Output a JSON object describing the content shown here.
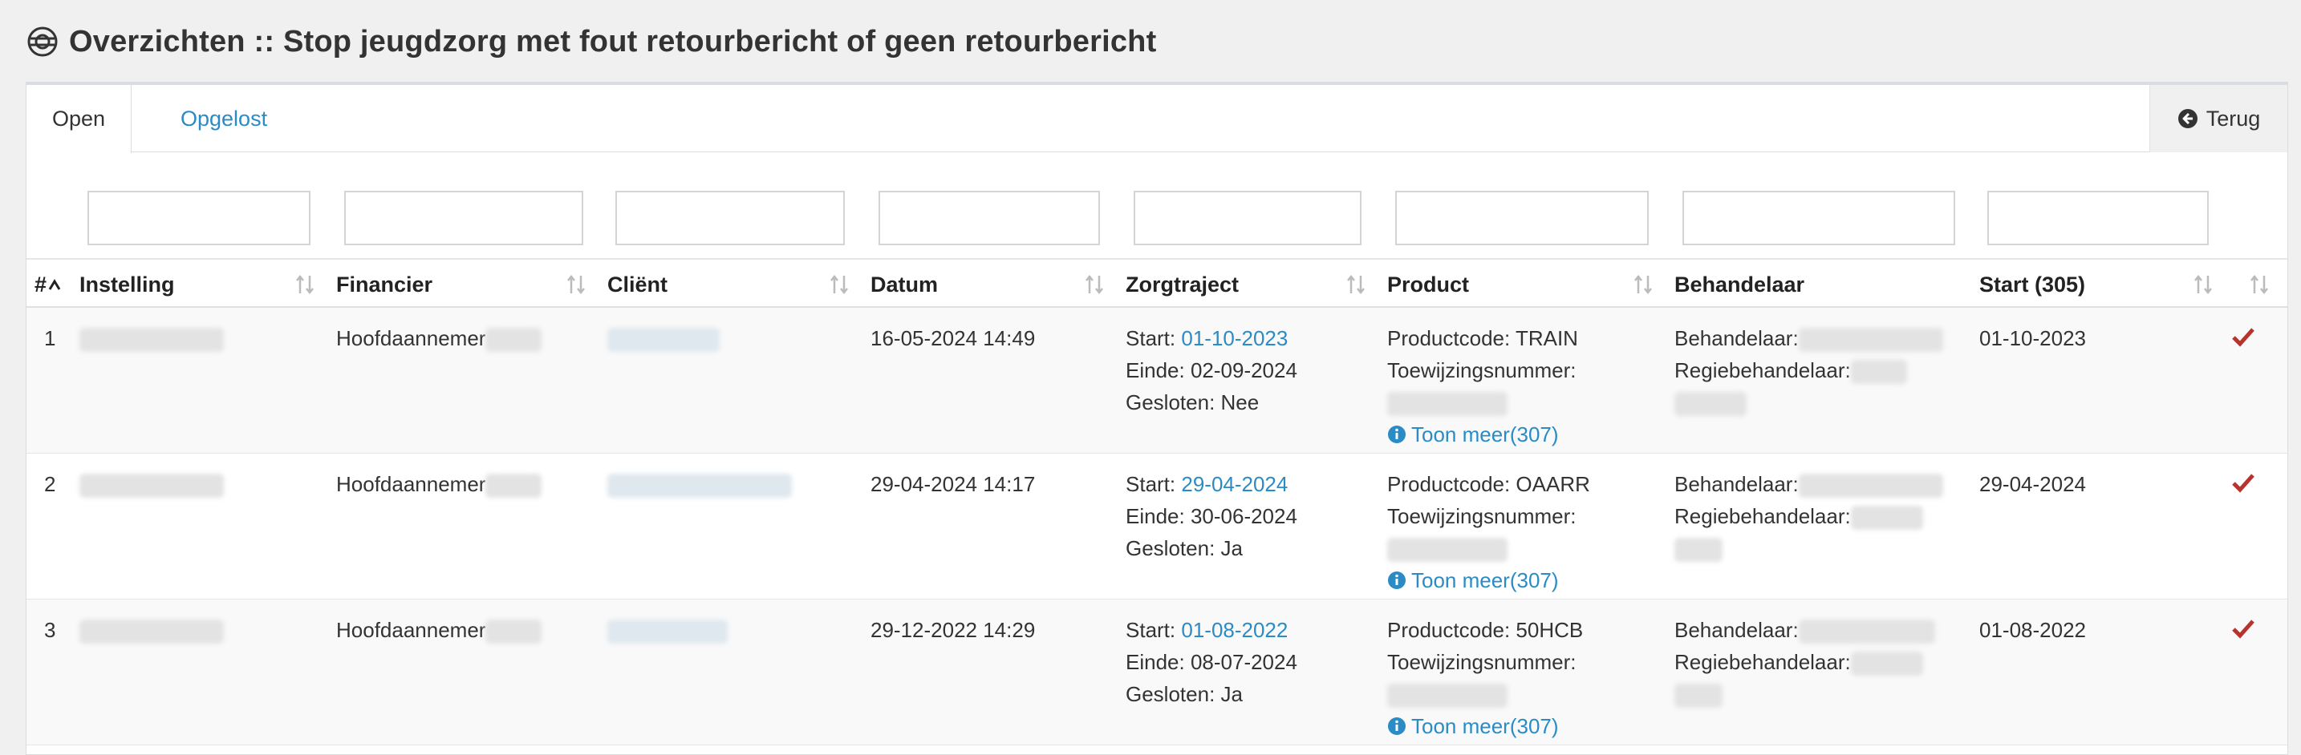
{
  "header": {
    "title": "Overzichten :: Stop jeugdzorg met fout retourbericht of geen retourbericht"
  },
  "tabs": [
    {
      "label": "Open"
    },
    {
      "label": "Opgelost"
    }
  ],
  "back_button": {
    "label": "Terug"
  },
  "columns": [
    {
      "label": "#"
    },
    {
      "label": "Instelling"
    },
    {
      "label": "Financier"
    },
    {
      "label": "Cliënt"
    },
    {
      "label": "Datum"
    },
    {
      "label": "Zorgtraject"
    },
    {
      "label": "Product"
    },
    {
      "label": "Behandelaar"
    },
    {
      "label": "Start (305)"
    }
  ],
  "rows": [
    {
      "nr": "1",
      "financier": "Hoofdaannemer",
      "datum": "16-05-2024 14:49",
      "start_label": "Start: ",
      "start_link": "01-10-2023",
      "einde": "Einde: 02-09-2024",
      "gesloten": "Gesloten: Nee",
      "productcode": "Productcode: TRAIN",
      "toewijzing": "Toewijzingsnummer:",
      "toon_meer": "Toon meer(307)",
      "behandelaar": "Behandelaar:",
      "regie": "Regiebehandelaar:",
      "start305": "01-10-2023"
    },
    {
      "nr": "2",
      "financier": "Hoofdaannemer",
      "datum": "29-04-2024 14:17",
      "start_label": "Start: ",
      "start_link": "29-04-2024",
      "einde": "Einde: 30-06-2024",
      "gesloten": "Gesloten: Ja",
      "productcode": "Productcode: OAARR",
      "toewijzing": "Toewijzingsnummer:",
      "toon_meer": "Toon meer(307)",
      "behandelaar": "Behandelaar:",
      "regie": "Regiebehandelaar:",
      "start305": "29-04-2024"
    },
    {
      "nr": "3",
      "financier": "Hoofdaannemer",
      "datum": "29-12-2022 14:29",
      "start_label": "Start: ",
      "start_link": "01-08-2022",
      "einde": "Einde: 08-07-2024",
      "gesloten": "Gesloten: Ja",
      "productcode": "Productcode: 50HCB",
      "toewijzing": "Toewijzingsnummer:",
      "toon_meer": "Toon meer(307)",
      "behandelaar": "Behandelaar:",
      "regie": "Regiebehandelaar:",
      "start305": "01-08-2022"
    }
  ],
  "colors": {
    "link": "#2a8bc5",
    "check": "#b5352e",
    "header_bg": "#f0f0f0"
  },
  "icons": {
    "title": "lifebuoy-icon",
    "back": "arrow-circle-left-icon",
    "sort": "sort-icon",
    "status": "check-icon",
    "info": "info-circle-icon"
  }
}
